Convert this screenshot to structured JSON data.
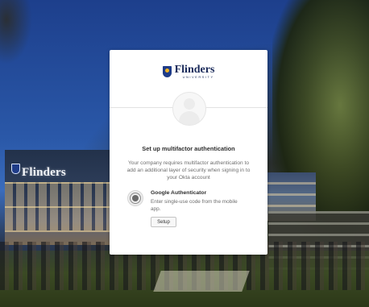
{
  "background": {
    "building_sign": "Flinders"
  },
  "card": {
    "logo": {
      "name": "Flinders",
      "subtitle": "UNIVERSITY"
    },
    "title": "Set up multifactor authentication",
    "description": "Your company requires multifactor authentication to add an additional layer of security when signing in to your Okta account",
    "factors": [
      {
        "icon": "google-authenticator-icon",
        "name": "Google Authenticator",
        "description": "Enter single-use code from the mobile app.",
        "button_label": "Setup"
      }
    ]
  },
  "colors": {
    "brand_navy": "#1f3c88",
    "brand_gold": "#f0b323",
    "card_bg": "#ffffff"
  }
}
